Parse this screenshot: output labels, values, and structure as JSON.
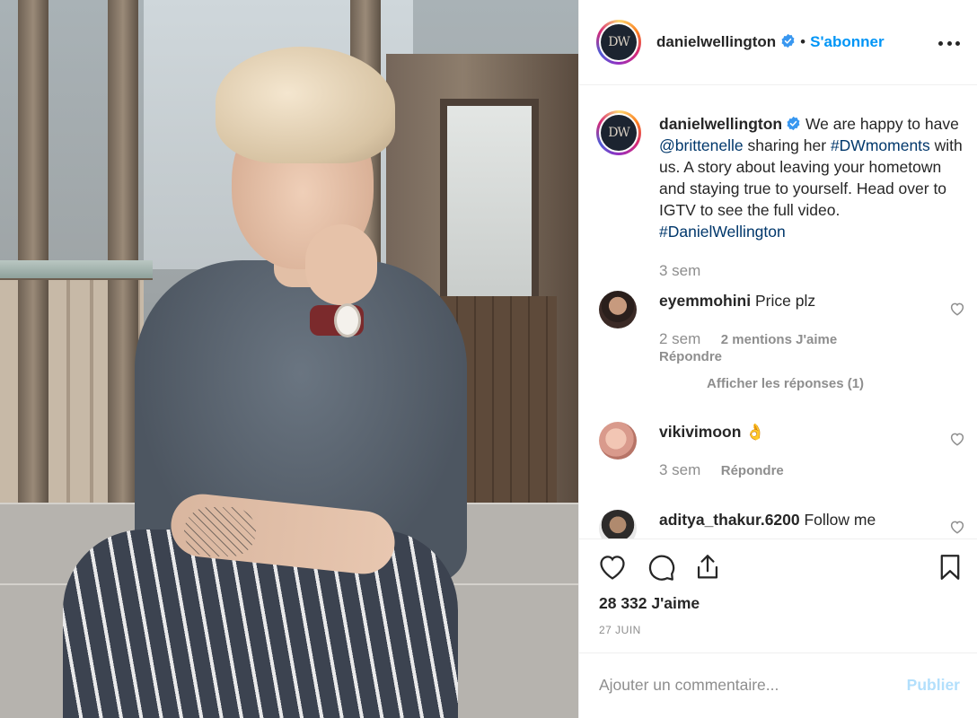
{
  "post_author": {
    "username": "danielwellington",
    "avatar_text": "DW",
    "verified": true,
    "separator": "•",
    "follow_label": "S'abonner"
  },
  "caption": {
    "username": "danielwellington",
    "part1": " We are happy to have ",
    "mention": "@brittenelle",
    "part2": " sharing her ",
    "hashtag1": "#DWmoments",
    "part3": " with us. A story about leaving your hometown and staying true to yourself. Head over to IGTV to see the full video. ",
    "hashtag2": "#DanielWellington",
    "time": "3 sem"
  },
  "comments": [
    {
      "username": "eyemmohini",
      "text": " Price plz",
      "time": "2 sem",
      "likes": "2 mentions J'aime",
      "reply": "Répondre",
      "view_replies": "Afficher les réponses (1)"
    },
    {
      "username": "vikivimoon",
      "text": " 👌",
      "time": "3 sem",
      "reply": "Répondre"
    },
    {
      "username": "aditya_thakur.6200",
      "text": " Follow me"
    }
  ],
  "actions": {
    "like_count": "28 332 J'aime",
    "date": "27 JUIN"
  },
  "comment_box": {
    "placeholder": "Ajouter un commentaire...",
    "publish_label": "Publier"
  },
  "colors": {
    "accent": "#0095f6",
    "link": "#00376b",
    "muted": "#8e8e8e",
    "publish_disabled": "#b2dffc"
  }
}
